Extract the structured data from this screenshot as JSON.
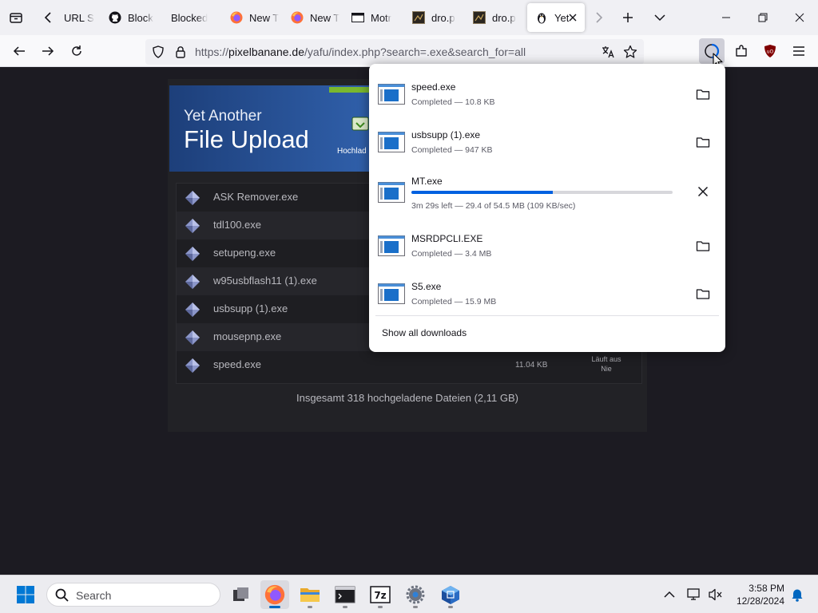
{
  "browser": {
    "tabs": [
      {
        "label": "URL S",
        "icon": "generic-page-icon"
      },
      {
        "label": "Block",
        "icon": "github-icon"
      },
      {
        "label": "Blocked",
        "icon": "none"
      },
      {
        "label": "New T",
        "icon": "firefox-icon"
      },
      {
        "label": "New T",
        "icon": "firefox-icon"
      },
      {
        "label": "Motr",
        "icon": "terminal-icon"
      },
      {
        "label": "dro.p",
        "icon": "file-thumbnail-icon"
      },
      {
        "label": "dro.p",
        "icon": "file-thumbnail-icon"
      },
      {
        "label": "Yet",
        "icon": "yafu-penguin-icon",
        "active": true
      }
    ],
    "url": {
      "prefix": "https://",
      "host": "pixelbanane.de",
      "path": "/yafu/index.php?search=.exe&search_for=all"
    }
  },
  "page": {
    "banner": {
      "line1": "Yet Another",
      "line2": "File Upload",
      "label": "Hochlad"
    },
    "files": [
      {
        "name": "ASK Remover.exe",
        "size": "",
        "expires_line1": "",
        "expires_line2": ""
      },
      {
        "name": "tdl100.exe",
        "size": "",
        "expires_line1": "",
        "expires_line2": ""
      },
      {
        "name": "setupeng.exe",
        "size": "",
        "expires_line1": "",
        "expires_line2": ""
      },
      {
        "name": "w95usbflash11 (1).exe",
        "size": "",
        "expires_line1": "",
        "expires_line2": ""
      },
      {
        "name": "usbsupp (1).exe",
        "size": "",
        "expires_line1": "",
        "expires_line2": ""
      },
      {
        "name": "mousepnp.exe",
        "size": "",
        "expires_line1": "",
        "expires_line2": ""
      },
      {
        "name": "speed.exe",
        "size": "11.04 KB",
        "expires_line1": "Läuft aus",
        "expires_line2": "Nie"
      }
    ],
    "total": "Insgesamt 318 hochgeladene Dateien (2,11 GB)"
  },
  "downloads": {
    "items": [
      {
        "name": "speed.exe",
        "status": "Completed — 10.8 KB",
        "action": "folder-icon"
      },
      {
        "name": "usbsupp (1).exe",
        "status": "Completed — 947 KB",
        "action": "folder-icon"
      },
      {
        "name": "MT.exe",
        "status": "3m 29s left — 29.4 of 54.5 MB (109 KB/sec)",
        "action": "cancel-icon",
        "progress": 0.54
      },
      {
        "name": "MSRDPCLI.EXE",
        "status": "Completed — 3.4 MB",
        "action": "folder-icon"
      },
      {
        "name": "S5.exe",
        "status": "Completed — 15.9 MB",
        "action": "folder-icon"
      }
    ],
    "show_all": "Show all downloads"
  },
  "taskbar": {
    "search_placeholder": "Search",
    "time": "3:58 PM",
    "date": "12/28/2024"
  },
  "colors": {
    "accent": "#0061e0",
    "page_bg": "#1c1b22",
    "taskbar_accent": "#0067c0"
  }
}
